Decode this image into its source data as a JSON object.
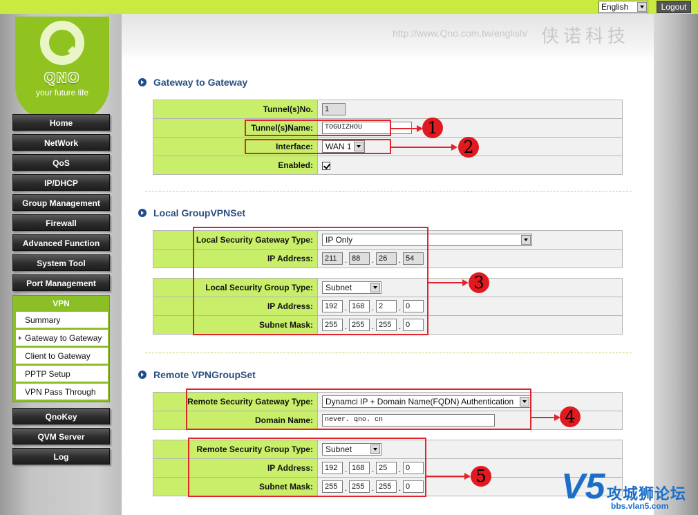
{
  "header": {
    "language": "English",
    "logout_label": "Logout",
    "url_text": "http://www.Qno.com.tw/english/",
    "company_cn": "侠诺科技"
  },
  "logo": {
    "brand": "QNO",
    "tagline": "your future life"
  },
  "nav": {
    "items": [
      "Home",
      "NetWork",
      "QoS",
      "IP/DHCP",
      "Group Management",
      "Firewall",
      "Advanced Function",
      "System Tool",
      "Port Management"
    ],
    "vpn_label": "VPN",
    "vpn_items": [
      "Summary",
      "Gateway to Gateway",
      "Client to Gateway",
      "PPTP Setup",
      "VPN Pass Through"
    ],
    "vpn_active": "Gateway to Gateway",
    "bottom_items": [
      "QnoKey",
      "QVM Server",
      "Log"
    ]
  },
  "sections": {
    "g2g": {
      "title": "Gateway to Gateway",
      "tunnel_no_label": "Tunnel(s)No.",
      "tunnel_no_value": "1",
      "tunnel_name_label": "Tunnel(s)Name:",
      "tunnel_name_value": "TOGUIZHOU",
      "interface_label": "Interface:",
      "interface_value": "WAN 1",
      "enabled_label": "Enabled:",
      "enabled_checked": true
    },
    "local": {
      "title": "Local GroupVPNSet",
      "gw_type_label": "Local Security Gateway Type:",
      "gw_type_value": "IP Only",
      "ip_label": "IP Address:",
      "ip": [
        "211",
        "88",
        "26",
        "54"
      ],
      "group_type_label": "Local Security Group Type:",
      "group_type_value": "Subnet",
      "group_ip_label": "IP Address:",
      "group_ip": [
        "192",
        "168",
        "2",
        "0"
      ],
      "mask_label": "Subnet Mask:",
      "mask": [
        "255",
        "255",
        "255",
        "0"
      ]
    },
    "remote": {
      "title": "Remote VPNGroupSet",
      "gw_type_label": "Remote Security Gateway Type:",
      "gw_type_value": "Dynamci IP + Domain Name(FQDN) Authentication",
      "domain_label": "Domain Name:",
      "domain_value": "never. qno. cn",
      "group_type_label": "Remote Security Group Type:",
      "group_type_value": "Subnet",
      "group_ip_label": "IP Address:",
      "group_ip": [
        "192",
        "168",
        "25",
        "0"
      ],
      "mask_label": "Subnet Mask:",
      "mask": [
        "255",
        "255",
        "255",
        "0"
      ]
    }
  },
  "annotations": {
    "callouts": [
      "1",
      "2",
      "3",
      "4",
      "5"
    ],
    "color": "#e0242c"
  },
  "watermark": {
    "logo": "V5",
    "text": "攻城狮论坛",
    "sub": "bbs.vlan5.com"
  },
  "colors": {
    "accent_green": "#c9ea3e",
    "label_green": "#c8ee6a",
    "title_blue": "#2a4f7f"
  }
}
